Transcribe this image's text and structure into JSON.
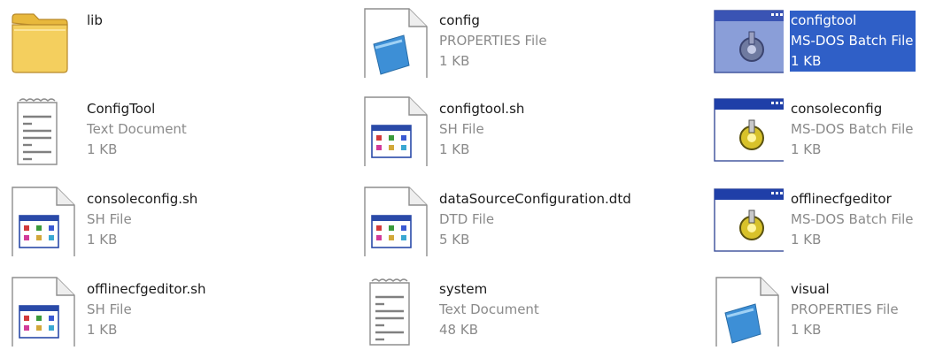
{
  "files": [
    {
      "name": "lib",
      "type": "",
      "size": "",
      "icon": "folder-icon",
      "selected": false
    },
    {
      "name": "config",
      "type": "PROPERTIES File",
      "size": "1 KB",
      "icon": "properties-file-icon",
      "selected": false
    },
    {
      "name": "configtool",
      "type": "MS-DOS Batch File",
      "size": "1 KB",
      "icon": "batch-file-icon",
      "selected": true
    },
    {
      "name": "ConfigTool",
      "type": "Text Document",
      "size": "1 KB",
      "icon": "text-document-icon",
      "selected": false
    },
    {
      "name": "configtool.sh",
      "type": "SH File",
      "size": "1 KB",
      "icon": "sh-file-icon",
      "selected": false
    },
    {
      "name": "consoleconfig",
      "type": "MS-DOS Batch File",
      "size": "1 KB",
      "icon": "batch-file-icon",
      "selected": false
    },
    {
      "name": "consoleconfig.sh",
      "type": "SH File",
      "size": "1 KB",
      "icon": "sh-file-icon",
      "selected": false
    },
    {
      "name": "dataSourceConfiguration.dtd",
      "type": "DTD File",
      "size": "5 KB",
      "icon": "dtd-file-icon",
      "selected": false
    },
    {
      "name": "offlinecfgeditor",
      "type": "MS-DOS Batch File",
      "size": "1 KB",
      "icon": "batch-file-icon",
      "selected": false
    },
    {
      "name": "offlinecfgeditor.sh",
      "type": "SH File",
      "size": "1 KB",
      "icon": "sh-file-icon",
      "selected": false
    },
    {
      "name": "system",
      "type": "Text Document",
      "size": "48 KB",
      "icon": "text-document-icon",
      "selected": false
    },
    {
      "name": "visual",
      "type": "PROPERTIES File",
      "size": "1 KB",
      "icon": "properties-file-icon",
      "selected": false
    }
  ],
  "colors": {
    "selection": "#2f5fc7",
    "name_text": "#1a1a1a",
    "meta_text": "#8a8a8a",
    "window_titlebar": "#2a4aa8"
  }
}
